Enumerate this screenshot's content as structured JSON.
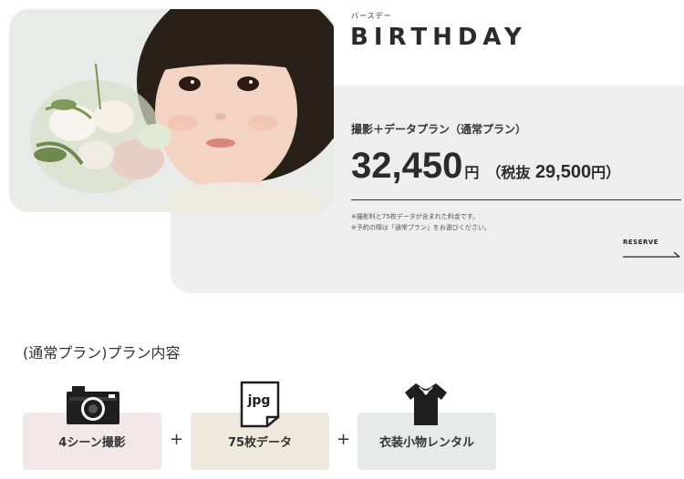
{
  "header": {
    "kana": "バースデー",
    "title": "BIRTHDAY"
  },
  "plan": {
    "label": "撮影＋データプラン（通常プラン）",
    "price": "32,450",
    "price_unit": "円",
    "tax_prefix": "（税抜 ",
    "tax_price": "29,500",
    "tax_suffix": "円）",
    "notes": [
      "※撮影料と75枚データが含まれた料金です。",
      "※予約の際は「通常プラン」をお選びください。"
    ],
    "reserve_label": "RESERVE"
  },
  "contents": {
    "title": "(通常プラン)プラン内容",
    "items": [
      {
        "label": "4シーン撮影",
        "icon": "camera-icon",
        "bg": "#f2e8e8"
      },
      {
        "label": "75枚データ",
        "icon": "jpg-file-icon",
        "bg": "#eee8dd"
      },
      {
        "label": "衣装小物レンタル",
        "icon": "dress-icon",
        "bg": "#e7eae8"
      }
    ],
    "plus": "+",
    "jpg_text": "jpg"
  }
}
